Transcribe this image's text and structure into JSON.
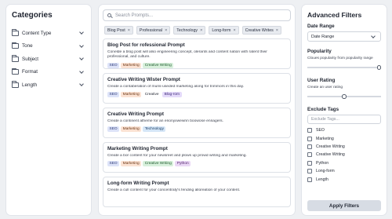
{
  "categories": {
    "title": "Categories",
    "items": [
      {
        "label": "Content Type"
      },
      {
        "label": "Tone"
      },
      {
        "label": "Subject"
      },
      {
        "label": "Format"
      },
      {
        "label": "Length"
      }
    ]
  },
  "search": {
    "placeholder": "Search Prompts..."
  },
  "active_chips": [
    "Blog Post",
    "Professional",
    "Technology",
    "Long-form",
    "Creative Writes"
  ],
  "prompts": [
    {
      "title": "Blog Post for   rofessional  Prompt",
      "desc": [
        "Conelde a blog post will also engineering concept, olerants and content nation with ratent their",
        "professional, and culture."
      ],
      "tags": [
        "SEO",
        "Marketing",
        "Creative Writing"
      ]
    },
    {
      "title": "Creative Writing Wister Prompt",
      "desc": [
        "Create a contaberation of muris-useded marketing along for tnmmors in this day."
      ],
      "tags": [
        "SEO",
        "Marketing",
        "Creative",
        "Blog-rom"
      ]
    },
    {
      "title": "Creative Writing Prompt",
      "desc": [
        "Create a continent atheme for an enonyxwewnn boowose ennagers."
      ],
      "tags": [
        "SEO",
        "Marketing",
        "Technology"
      ]
    },
    {
      "title": "Marketing Writing Prompt",
      "desc": [
        "Create a bor content for your newsreet and plows up prowd writing and marketing."
      ],
      "tags": [
        "SEO",
        "Marketing",
        "Creative Writing",
        "Python"
      ]
    },
    {
      "title": "Long-form Writing Prompt",
      "desc": [
        "Create a cull content for your concentraty's fending alloreation of your content."
      ],
      "tags": []
    }
  ],
  "filters": {
    "title": "Advanced Filters",
    "date_range": {
      "label": "Date Range",
      "value": "Date Range"
    },
    "popularity": {
      "label": "Popularity",
      "desc": "Cloues popularity from popularity range",
      "value": 1.0
    },
    "rating": {
      "label": "User Rating",
      "desc": "Create an user rating",
      "value": 0.5
    },
    "exclude": {
      "label": "Exclude Tags",
      "placeholder": "Exclude Tags...",
      "options": [
        "SEO",
        "Marketing",
        "Creative Writing",
        "Creative Writing",
        "Python",
        "Long-form",
        "Length"
      ]
    },
    "apply_label": "Apply Filters"
  }
}
